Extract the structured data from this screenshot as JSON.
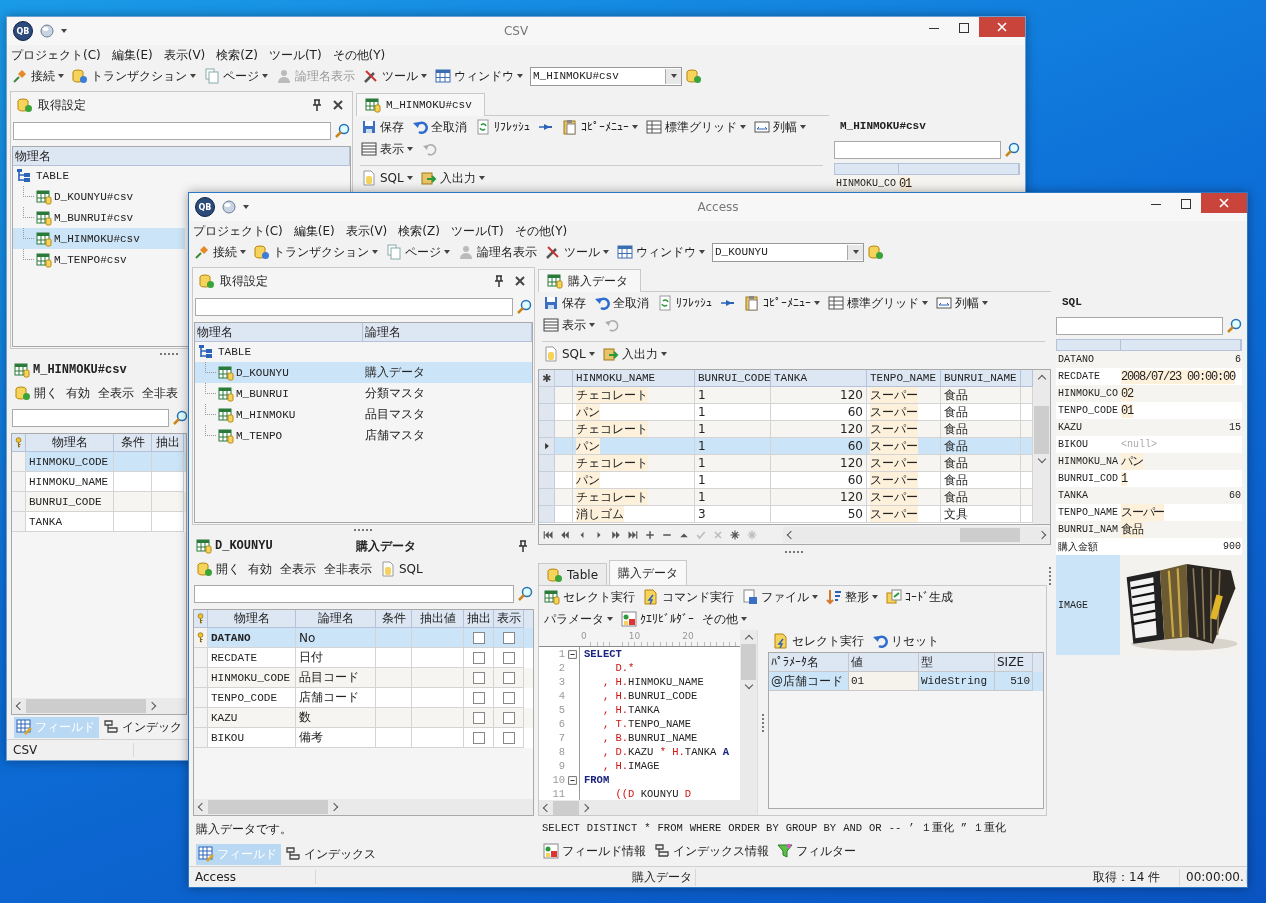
{
  "windows": [
    {
      "title": "CSV",
      "logo": "QB",
      "menu": [
        "プロジェクト(C)",
        "編集(E)",
        "表示(V)",
        "検索(Z)",
        "ツール(T)",
        "その他(Y)"
      ],
      "main_toolbar": [
        {
          "label": "接続",
          "dropdown": true,
          "disabled": false
        },
        {
          "label": "トランザクション",
          "dropdown": true,
          "disabled": false
        },
        {
          "label": "ページ",
          "dropdown": true,
          "disabled": false
        },
        {
          "label": "論理名表示",
          "dropdown": false,
          "disabled": true
        },
        {
          "label": "ツール",
          "dropdown": true,
          "disabled": false
        },
        {
          "label": "ウィンドウ",
          "dropdown": true,
          "disabled": false
        }
      ],
      "window_combo": "M_HINMOKU#csv",
      "settings_panel": {
        "title": "取得設定",
        "columns": [
          "物理名"
        ],
        "tree": {
          "label": "TABLE",
          "children": [
            {
              "name": "D_KOUNYU#csv",
              "selected": false
            },
            {
              "name": "M_BUNRUI#csv",
              "selected": false
            },
            {
              "name": "M_HINMOKU#csv",
              "selected": true
            },
            {
              "name": "M_TENPO#csv",
              "selected": false
            }
          ]
        }
      },
      "field_panel": {
        "title": "M_HINMOKU#csv",
        "toolbar": [
          "開く",
          "有効",
          "全表示",
          "全非表"
        ],
        "columns": [
          "物理名",
          "条件",
          "抽出"
        ],
        "rows": [
          {
            "name": "HINMOKU_CODE",
            "key": false,
            "selected": true
          },
          {
            "name": "HINMOKU_NAME",
            "key": false,
            "selected": false
          },
          {
            "name": "BUNRUI_CODE",
            "key": false,
            "selected": false
          },
          {
            "name": "TANKA",
            "key": false,
            "selected": false
          }
        ],
        "tabs": [
          {
            "label": "フィールド",
            "selected": true
          },
          {
            "label": "インデック",
            "selected": false
          }
        ]
      },
      "document": {
        "tab": "M_HINMOKU#csv",
        "toolbar_row1": [
          {
            "label": "保存",
            "dropdown": false
          },
          {
            "label": "全取消",
            "dropdown": false
          },
          {
            "label": "ﾘﾌﾚｯｼｭ",
            "dropdown": false
          },
          {
            "dropdown": false
          },
          {
            "label": "ｺﾋﾟｰﾒﾆｭｰ",
            "dropdown": true
          },
          {
            "label": "標準グリッド",
            "dropdown": true
          },
          {
            "label": "列幅",
            "dropdown": true
          }
        ],
        "toolbar_row2": [
          {
            "label": "表示",
            "dropdown": true
          },
          {
            "dropdown": false
          }
        ],
        "toolbar_row3": [
          {
            "label": "SQL",
            "dropdown": true
          },
          {
            "label": "入出力",
            "dropdown": true
          }
        ]
      },
      "record_panel": {
        "title": "M_HINMOKU#csv",
        "rows": [
          {
            "name": "HINMOKU_CO",
            "value": "01",
            "kind": "text",
            "selected": false
          }
        ]
      },
      "status_bar": [
        "CSV"
      ]
    },
    {
      "title": "Access",
      "logo": "QB",
      "menu": [
        "プロジェクト(C)",
        "編集(E)",
        "表示(V)",
        "検索(Z)",
        "ツール(T)",
        "その他(Y)"
      ],
      "main_toolbar": [
        {
          "label": "接続",
          "dropdown": true,
          "disabled": false
        },
        {
          "label": "トランザクション",
          "dropdown": true,
          "disabled": false
        },
        {
          "label": "ページ",
          "dropdown": true,
          "disabled": false
        },
        {
          "label": "論理名表示",
          "dropdown": false,
          "disabled": false
        },
        {
          "label": "ツール",
          "dropdown": true,
          "disabled": false
        },
        {
          "label": "ウィンドウ",
          "dropdown": true,
          "disabled": false
        }
      ],
      "window_combo": "D_KOUNYU",
      "settings_panel": {
        "title": "取得設定",
        "columns": [
          "物理名",
          "論理名"
        ],
        "tree": {
          "label": "TABLE",
          "children": [
            {
              "name": "D_KOUNYU",
              "logical": "購入データ",
              "selected": true
            },
            {
              "name": "M_BUNRUI",
              "logical": "分類マスタ",
              "selected": false
            },
            {
              "name": "M_HINMOKU",
              "logical": "品目マスタ",
              "selected": false
            },
            {
              "name": "M_TENPO",
              "logical": "店舗マスタ",
              "selected": false
            }
          ]
        }
      },
      "field_panel": {
        "title": "D_KOUNYU",
        "subtitle": "購入データ",
        "toolbar": [
          "開く",
          "有効",
          "全表示",
          "全非表示",
          "SQL"
        ],
        "columns": [
          "物理名",
          "論理名",
          "条件",
          "抽出値",
          "抽出",
          "表示"
        ],
        "rows": [
          {
            "name": "DATANO",
            "logical": "No",
            "key": true,
            "extract": false,
            "show": false,
            "selected": true
          },
          {
            "name": "RECDATE",
            "logical": "日付",
            "key": false,
            "extract": false,
            "show": false,
            "selected": false
          },
          {
            "name": "HINMOKU_CODE",
            "logical": "品目コード",
            "key": false,
            "extract": false,
            "show": false,
            "selected": false
          },
          {
            "name": "TENPO_CODE",
            "logical": "店舗コード",
            "key": false,
            "extract": false,
            "show": false,
            "selected": false
          },
          {
            "name": "KAZU",
            "logical": "数",
            "key": false,
            "extract": false,
            "show": false,
            "selected": false
          },
          {
            "name": "BIKOU",
            "logical": "備考",
            "key": false,
            "extract": false,
            "show": false,
            "selected": false
          }
        ],
        "description": "購入データです。",
        "tabs": [
          {
            "label": "フィールド",
            "selected": true
          },
          {
            "label": "インデックス",
            "selected": false
          }
        ]
      },
      "document": {
        "tab": "購入データ",
        "toolbar_row1": [
          {
            "label": "保存",
            "dropdown": false
          },
          {
            "label": "全取消",
            "dropdown": false
          },
          {
            "label": "ﾘﾌﾚｯｼｭ",
            "dropdown": false
          },
          {
            "dropdown": false
          },
          {
            "label": "ｺﾋﾟｰﾒﾆｭｰ",
            "dropdown": true
          },
          {
            "label": "標準グリッド",
            "dropdown": true
          },
          {
            "label": "列幅",
            "dropdown": true
          }
        ],
        "toolbar_row2": [
          {
            "label": "表示",
            "dropdown": true
          },
          {
            "dropdown": false
          }
        ],
        "toolbar_row3": [
          {
            "label": "SQL",
            "dropdown": true
          },
          {
            "label": "入出力",
            "dropdown": true
          }
        ],
        "grid": {
          "header_mark": "✱",
          "columns": [
            "HINMOKU_NAME",
            "BUNRUI_CODE",
            "TANKA",
            "TENPO_NAME",
            "BUNRUI_NAME"
          ],
          "rows": [
            {
              "cells": [
                "チェコレート",
                "1",
                "120",
                "スーパー",
                "食品"
              ],
              "selected": false
            },
            {
              "cells": [
                "パン",
                "1",
                "60",
                "スーパー",
                "食品"
              ],
              "selected": false
            },
            {
              "cells": [
                "チェコレート",
                "1",
                "120",
                "スーパー",
                "食品"
              ],
              "selected": false
            },
            {
              "cells": [
                "パン",
                "1",
                "60",
                "スーパー",
                "食品"
              ],
              "selected": true
            },
            {
              "cells": [
                "チェコレート",
                "1",
                "120",
                "スーパー",
                "食品"
              ],
              "selected": false
            },
            {
              "cells": [
                "パン",
                "1",
                "60",
                "スーパー",
                "食品"
              ],
              "selected": false
            },
            {
              "cells": [
                "チェコレート",
                "1",
                "120",
                "スーパー",
                "食品"
              ],
              "selected": false
            },
            {
              "cells": [
                "消しゴム",
                "3",
                "50",
                "スーパー",
                "文具"
              ],
              "selected": false
            }
          ]
        },
        "navigator": [
          {
            "kind": "first",
            "disabled": false
          },
          {
            "kind": "prior-page",
            "disabled": false
          },
          {
            "kind": "prior",
            "disabled": false
          },
          {
            "kind": "next",
            "disabled": false
          },
          {
            "kind": "next-page",
            "disabled": false
          },
          {
            "kind": "last",
            "disabled": false
          },
          {
            "kind": "insert",
            "disabled": false
          },
          {
            "kind": "delete",
            "disabled": false
          },
          {
            "kind": "edit",
            "disabled": false
          },
          {
            "kind": "post",
            "disabled": true
          },
          {
            "kind": "cancel",
            "disabled": true
          },
          {
            "kind": "refresh",
            "disabled": false
          },
          {
            "kind": "bookmark",
            "disabled": true
          }
        ],
        "lower_tabs": [
          {
            "label": "Table",
            "selected": false
          },
          {
            "label": "購入データ",
            "selected": true
          }
        ],
        "lower_toolbar1": [
          {
            "label": "セレクト実行",
            "dropdown": false
          },
          {
            "label": "コマンド実行",
            "dropdown": false
          },
          {
            "label": "ファイル",
            "dropdown": true
          },
          {
            "label": "整形",
            "dropdown": true
          },
          {
            "label": "ｺｰﾄﾞ生成",
            "dropdown": false
          }
        ],
        "lower_toolbar2": [
          {
            "label": "パラメータ",
            "dropdown": true
          },
          {
            "label": "ｸｴﾘﾋﾞﾙﾀﾞｰ",
            "dropdown": false
          },
          {
            "label": "その他",
            "dropdown": true
          }
        ],
        "editor": {
          "ruler": [
            "0",
            "10",
            "20"
          ],
          "lines": [
            {
              "number": "1",
              "fold": true,
              "tokens": [
                {
                  "text": "SELECT",
                  "kind": "keyword"
                }
              ]
            },
            {
              "number": "2",
              "fold": false,
              "tokens": [
                {
                  "text": "     D.*",
                  "kind": "alias"
                }
              ]
            },
            {
              "number": "3",
              "fold": false,
              "tokens": [
                {
                  "text": "   , H.",
                  "kind": "alias"
                },
                {
                  "text": "HINMOKU_NAME",
                  "kind": "plain"
                }
              ]
            },
            {
              "number": "4",
              "fold": false,
              "tokens": [
                {
                  "text": "   , H.",
                  "kind": "alias"
                },
                {
                  "text": "BUNRUI_CODE",
                  "kind": "plain"
                }
              ]
            },
            {
              "number": "5",
              "fold": false,
              "tokens": [
                {
                  "text": "   , H.",
                  "kind": "alias"
                },
                {
                  "text": "TANKA",
                  "kind": "plain"
                }
              ]
            },
            {
              "number": "6",
              "fold": false,
              "tokens": [
                {
                  "text": "   , T.",
                  "kind": "alias"
                },
                {
                  "text": "TENPO_NAME",
                  "kind": "plain"
                }
              ]
            },
            {
              "number": "7",
              "fold": false,
              "tokens": [
                {
                  "text": "   , B.",
                  "kind": "alias"
                },
                {
                  "text": "BUNRUI_NAME",
                  "kind": "plain"
                }
              ]
            },
            {
              "number": "8",
              "fold": false,
              "tokens": [
                {
                  "text": "   , D.",
                  "kind": "alias"
                },
                {
                  "text": "KAZU ",
                  "kind": "plain"
                },
                {
                  "text": "* H.",
                  "kind": "alias"
                },
                {
                  "text": "TANKA ",
                  "kind": "plain"
                },
                {
                  "text": "A",
                  "kind": "keyword"
                }
              ]
            },
            {
              "number": "9",
              "fold": false,
              "tokens": [
                {
                  "text": "   , H.",
                  "kind": "alias"
                },
                {
                  "text": "IMAGE",
                  "kind": "plain"
                }
              ]
            },
            {
              "number": "10",
              "fold": true,
              "tokens": [
                {
                  "text": "FROM",
                  "kind": "keyword"
                }
              ]
            },
            {
              "number": "11",
              "fold": false,
              "tokens": [
                {
                  "text": "     ((D",
                  "kind": "alias"
                },
                {
                  "text": " KOUNYU ",
                  "kind": "plain"
                },
                {
                  "text": "D",
                  "kind": "alias"
                }
              ]
            }
          ]
        },
        "params": {
          "toolbar": [
            "セレクト実行",
            "リセット"
          ],
          "columns": [
            "ﾊﾟﾗﾒｰﾀ名",
            "値",
            "型",
            "SIZE"
          ],
          "rows": [
            {
              "cells": [
                "@店舗コード",
                "01",
                "WideString",
                "510"
              ],
              "selected": true
            }
          ]
        },
        "keywords": [
          "SELECT",
          "DISTINCT",
          "*",
          "FROM",
          "WHERE",
          "ORDER BY",
          "GROUP BY",
          "AND",
          "OR",
          "--",
          "’ １重化",
          "” １重化"
        ],
        "info_buttons": [
          "フィールド情報",
          "インデックス情報",
          "フィルター"
        ]
      },
      "record_panel": {
        "title": "SQL",
        "rows": [
          {
            "name": "DATANO",
            "value": "6",
            "kind": "number",
            "selected": false
          },
          {
            "name": "RECDATE",
            "value": "2008/07/23 00:00:00",
            "kind": "text",
            "selected": false
          },
          {
            "name": "HINMOKU_CO",
            "value": "02",
            "kind": "text",
            "selected": false
          },
          {
            "name": "TENPO_CODE",
            "value": "01",
            "kind": "text",
            "selected": false
          },
          {
            "name": "KAZU",
            "value": "15",
            "kind": "number",
            "selected": false
          },
          {
            "name": "BIKOU",
            "value": "<null>",
            "kind": "null",
            "selected": false
          },
          {
            "name": "HINMOKU_NA",
            "value": "パン",
            "kind": "text",
            "selected": false
          },
          {
            "name": "BUNRUI_COD",
            "value": "1",
            "kind": "text",
            "selected": false
          },
          {
            "name": "TANKA",
            "value": "60",
            "kind": "number",
            "selected": false
          },
          {
            "name": "TENPO_NAME",
            "value": "スーパー",
            "kind": "text",
            "selected": false
          },
          {
            "name": "BUNRUI_NAM",
            "value": "食品",
            "kind": "text",
            "selected": false
          },
          {
            "name": "購入金額",
            "value": "900",
            "kind": "number",
            "selected": false
          },
          {
            "name": "IMAGE",
            "kind": "picture",
            "selected": true
          }
        ]
      },
      "status_bar": [
        "Access",
        "購入データ",
        "取得：14 件",
        "00:00:00."
      ]
    }
  ]
}
